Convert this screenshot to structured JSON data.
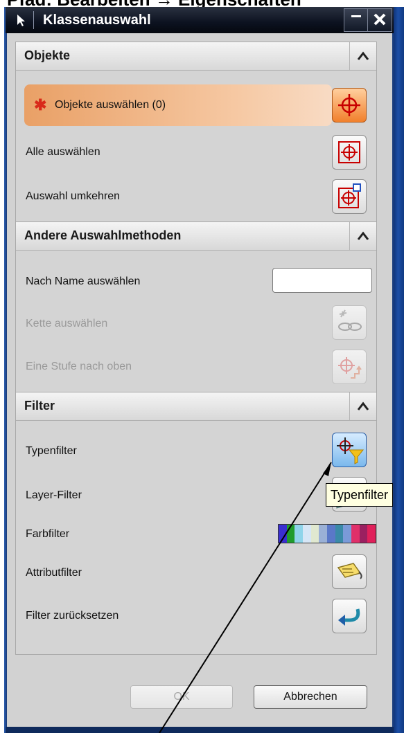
{
  "caption": "Pfad: Bearbeiten → Eigenschaften",
  "window": {
    "title": "Klassenauswahl",
    "minimize_label": "–",
    "close_label": "✕"
  },
  "sections": {
    "objekte": {
      "title": "Objekte",
      "toggle": "^",
      "select_objects": "Objekte auswählen (0)",
      "select_all": "Alle auswählen",
      "invert_selection": "Auswahl umkehren"
    },
    "other_methods": {
      "title": "Andere Auswahlmethoden",
      "toggle": "^",
      "by_name": "Nach Name auswählen",
      "by_name_value": "",
      "chain": "Kette auswählen",
      "level_up": "Eine Stufe nach oben"
    },
    "filter": {
      "title": "Filter",
      "toggle": "^",
      "type_filter": "Typenfilter",
      "layer_filter": "Layer-Filter",
      "color_filter": "Farbfilter",
      "attribute_filter": "Attributfilter",
      "reset_filter": "Filter zurücksetzen"
    }
  },
  "buttons": {
    "ok": "OK",
    "cancel": "Abbrechen"
  },
  "tooltip": "Typenfilter",
  "color_filter_swatches": [
    "#3a2fd0",
    "#1f9c2c",
    "#8fd4ea",
    "#d6e6f6",
    "#e0e8d0",
    "#9ab0d6",
    "#5a78c8",
    "#3a8aa8",
    "#7a9ad8",
    "#e0306a",
    "#9a2060",
    "#e0205a"
  ]
}
